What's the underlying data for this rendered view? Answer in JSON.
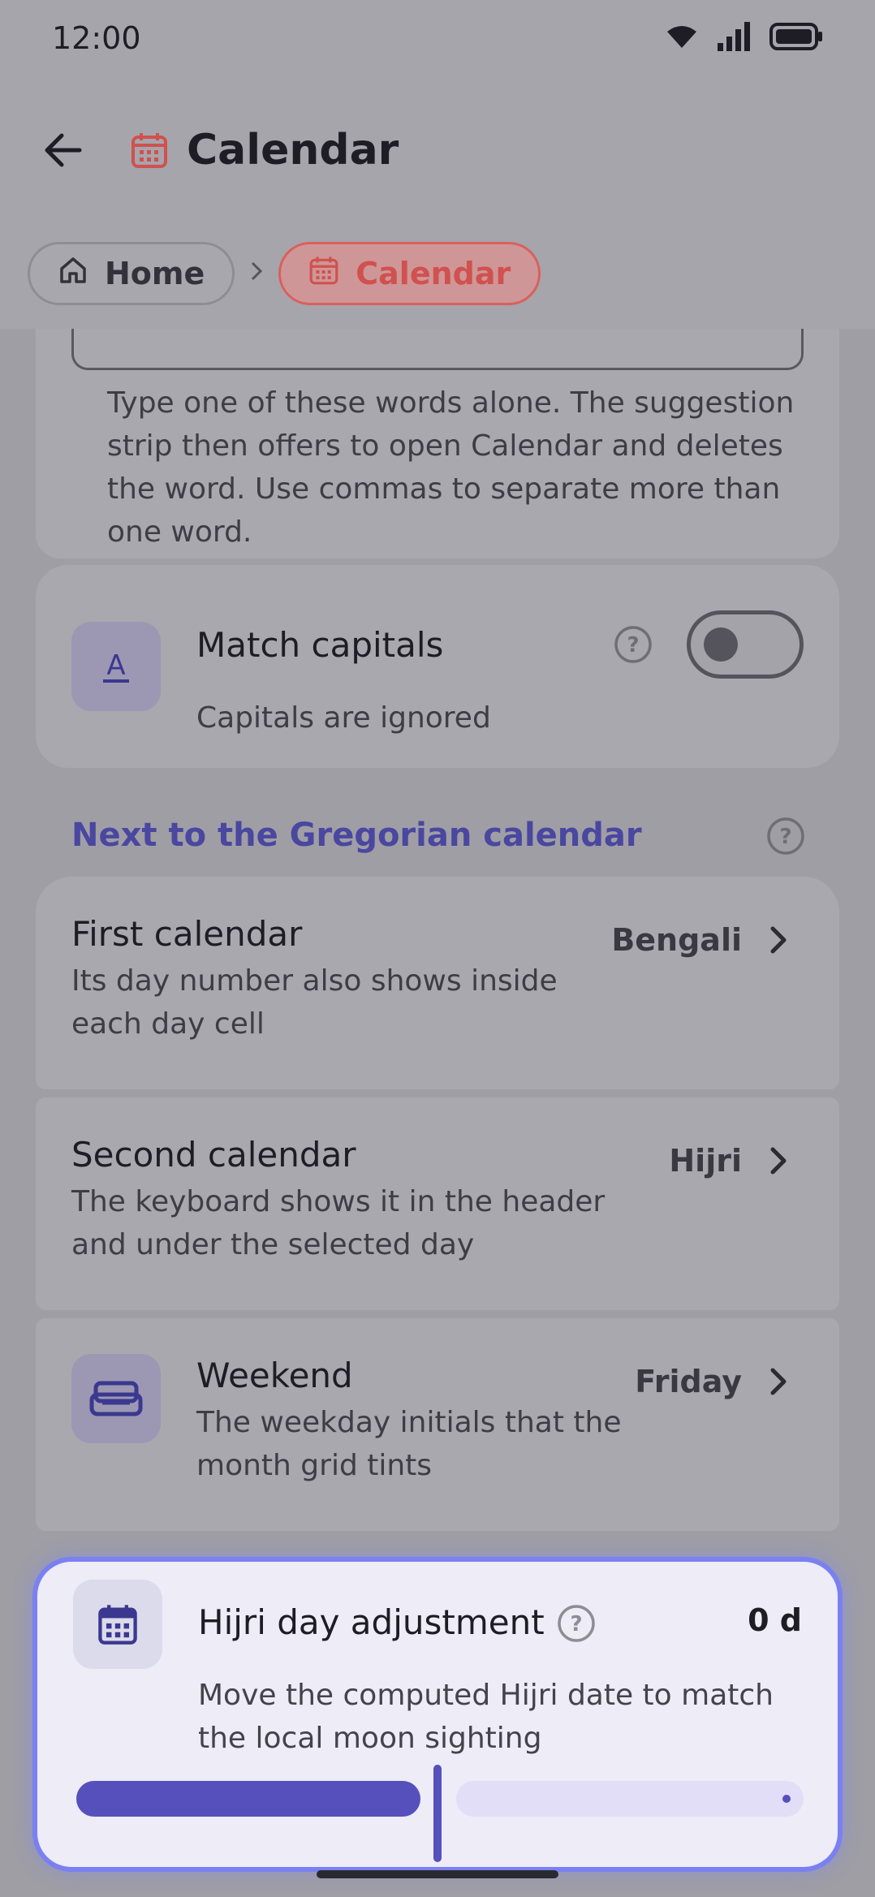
{
  "status": {
    "time": "12:00"
  },
  "appbar": {
    "title": "Calendar"
  },
  "breadcrumb": {
    "home": "Home",
    "current": "Calendar"
  },
  "keywords": {
    "description": "Type one of these words alone. The suggestion strip then offers to open Calendar and deletes the word. Use commas to separate more than one word."
  },
  "match_capitals": {
    "title": "Match capitals",
    "subtitle": "Capitals are ignored",
    "enabled": false
  },
  "section": {
    "title": "Next to the Gregorian calendar"
  },
  "first_calendar": {
    "title": "First calendar",
    "description": "Its day number also shows inside each day cell",
    "value": "Bengali"
  },
  "second_calendar": {
    "title": "Second calendar",
    "description": "The keyboard shows it in the header and under the selected day",
    "value": "Hijri"
  },
  "weekend": {
    "title": "Weekend",
    "description": "The weekday initials that the month grid tints",
    "value": "Friday"
  },
  "hijri_adjust": {
    "title": "Hijri day adjustment",
    "description": "Move the computed Hijri date to match the local moon sighting",
    "value": "0 d",
    "slider_fraction": 0.5
  },
  "colors": {
    "accent": "#5550BB",
    "brand_red": "#D0514F",
    "section": "#4A47A0"
  }
}
